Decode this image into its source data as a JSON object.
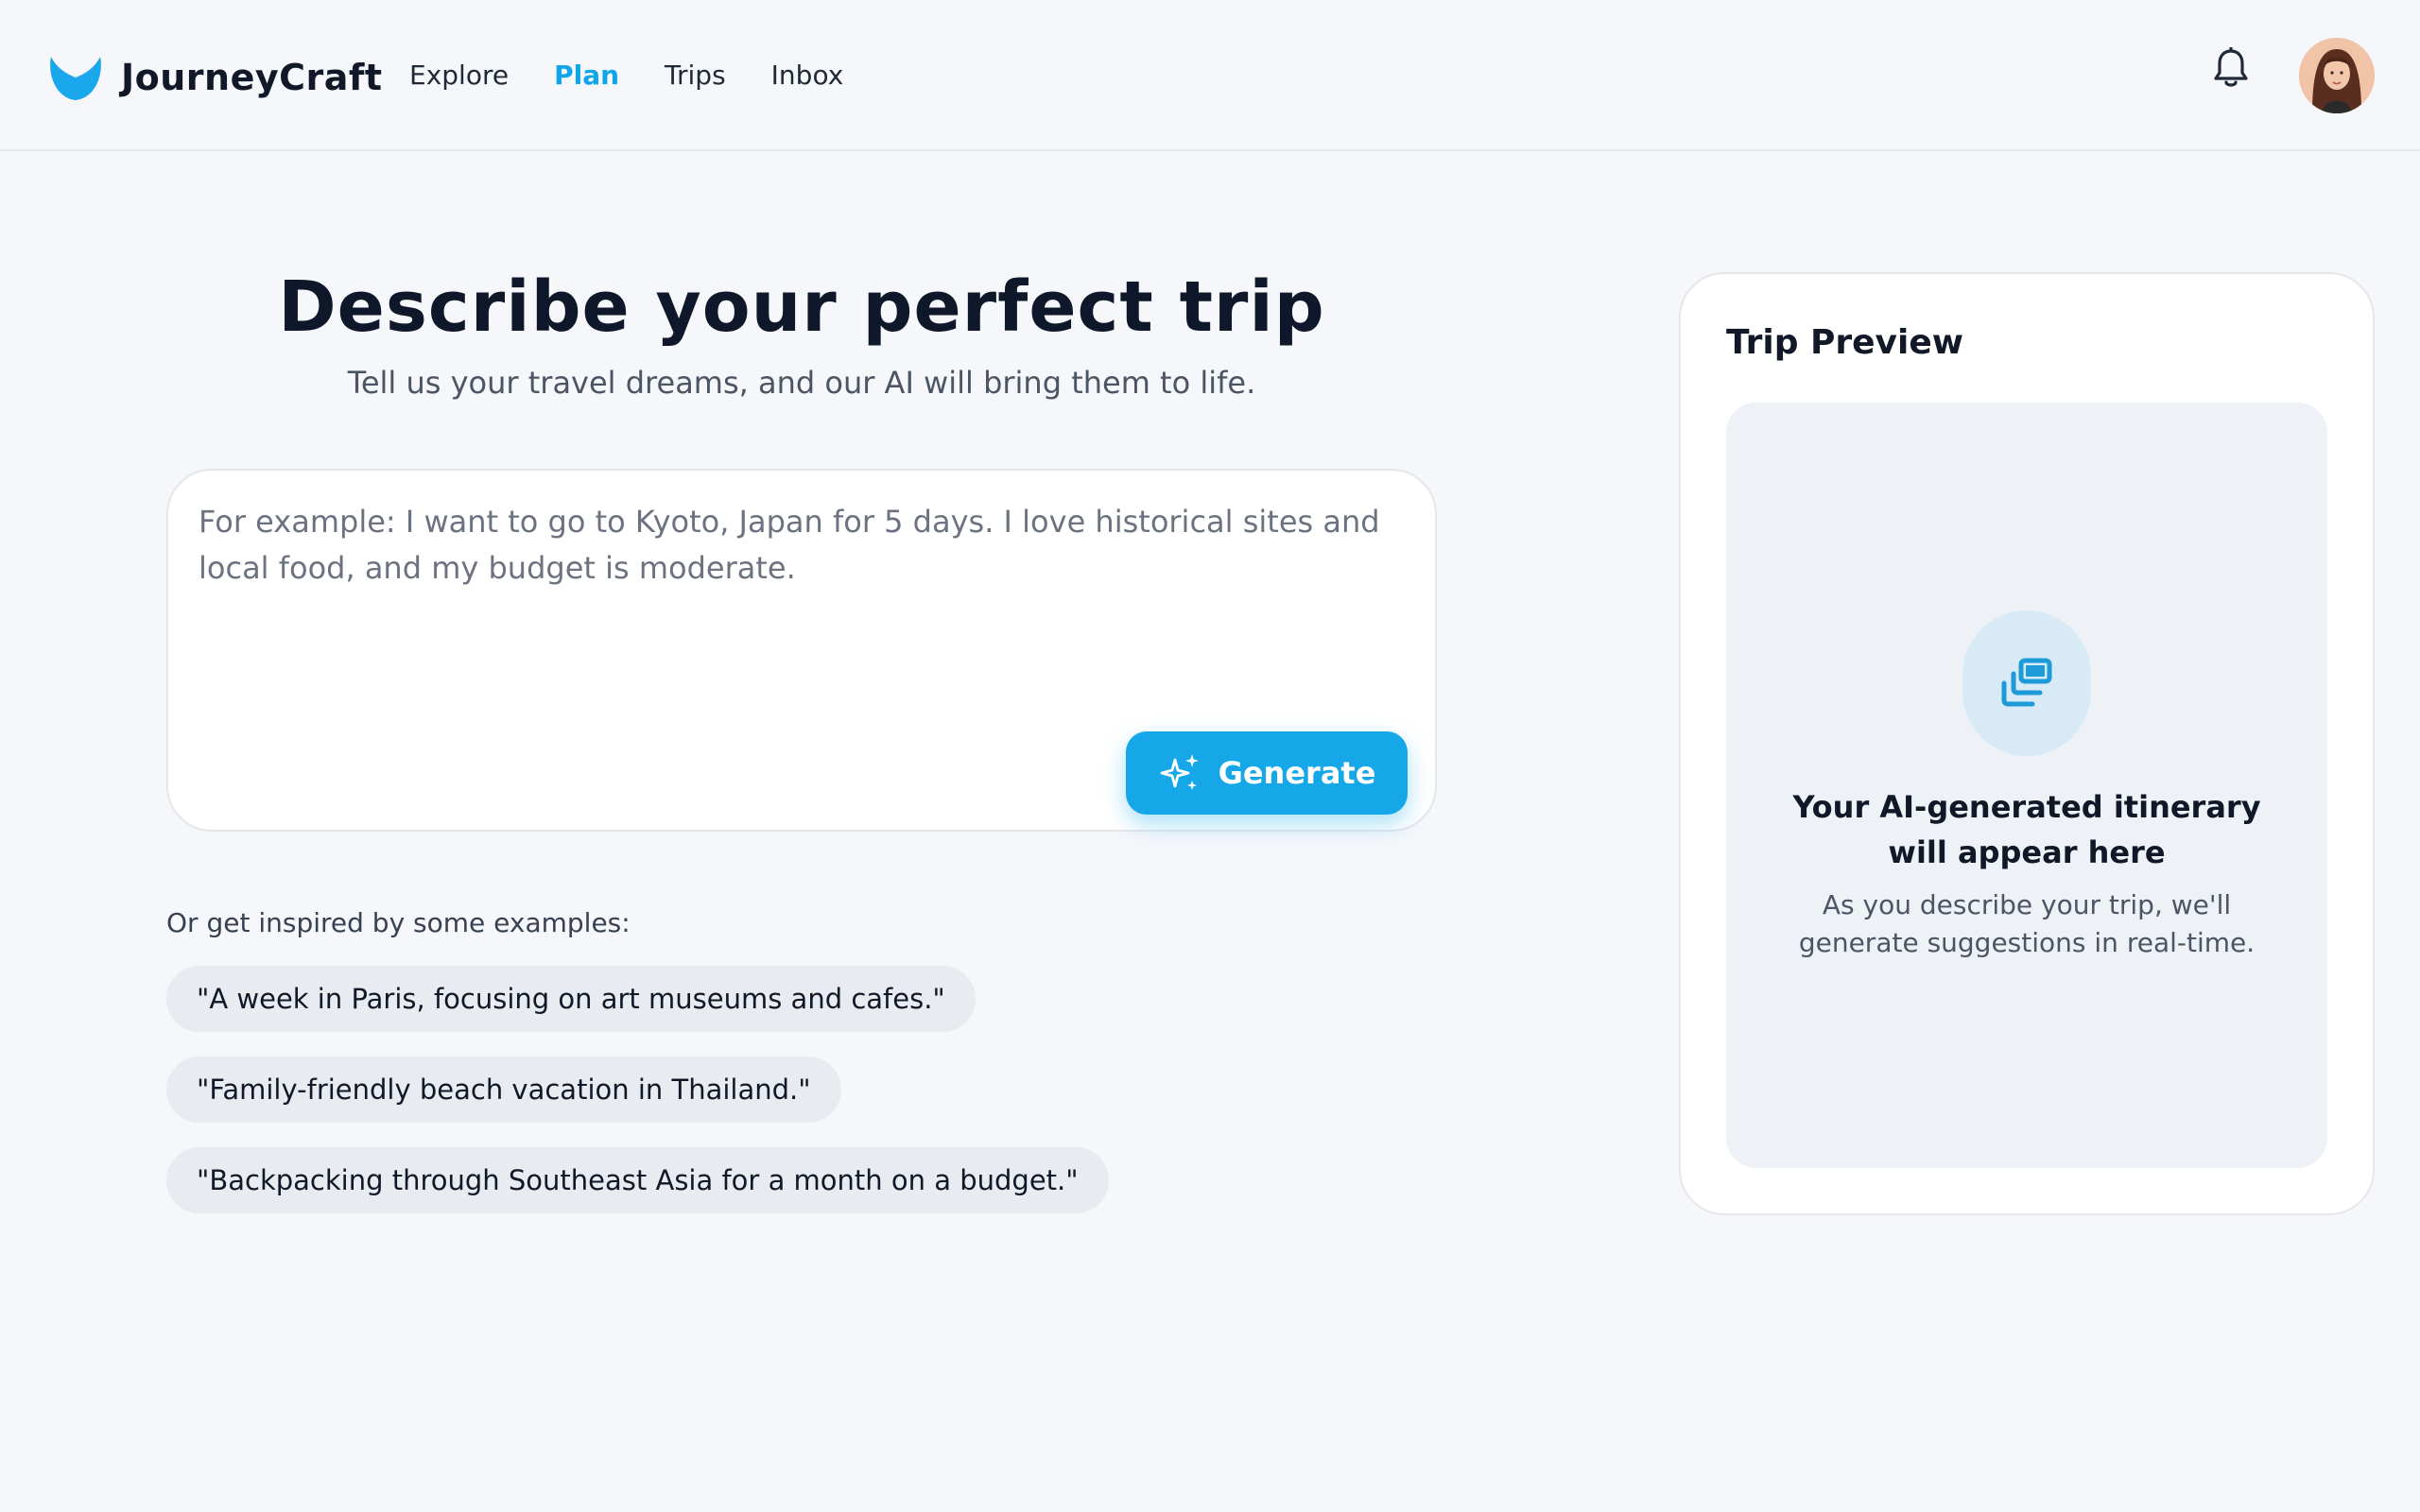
{
  "app": {
    "name": "JourneyCraft",
    "brand_color": "#0ea5e9"
  },
  "nav": {
    "items": [
      {
        "label": "Explore",
        "active": false
      },
      {
        "label": "Plan",
        "active": true
      },
      {
        "label": "Trips",
        "active": false
      },
      {
        "label": "Inbox",
        "active": false
      }
    ]
  },
  "header_icons": {
    "notifications": "bell-icon",
    "profile": "user-avatar"
  },
  "hero": {
    "title": "Describe your perfect trip",
    "subtitle": "Tell us your travel dreams, and our AI will bring them to life."
  },
  "prompt": {
    "value": "",
    "placeholder": "For example: I want to go to Kyoto, Japan for 5 days. I love historical sites and local food, and my budget is moderate.",
    "generate_label": "Generate",
    "generate_icon": "sparkles-icon"
  },
  "inspiration": {
    "label": "Or get inspired by some examples:",
    "examples": [
      "\"A week in Paris, focusing on art museums and cafes.\"",
      "\"Family-friendly beach vacation in Thailand.\"",
      "\"Backpacking through Southeast Asia for a month on a budget.\""
    ]
  },
  "preview": {
    "title": "Trip Preview",
    "icon": "itinerary-cards-icon",
    "heading": "Your AI-generated itinerary will appear here",
    "description": "As you describe your trip, we'll generate suggestions in real-time."
  }
}
